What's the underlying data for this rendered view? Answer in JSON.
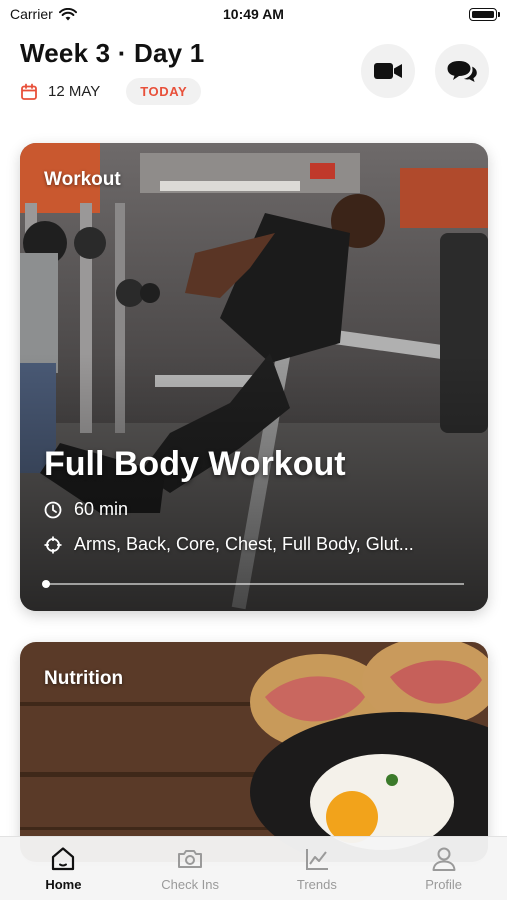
{
  "status_bar": {
    "carrier": "Carrier",
    "time": "10:49 AM"
  },
  "header": {
    "title": "Week 3 · Day 1",
    "date": "12 MAY",
    "today_label": "TODAY"
  },
  "workout_card": {
    "category": "Workout",
    "title": "Full Body Workout",
    "duration": "60 min",
    "targets": "Arms, Back, Core, Chest, Full Body, Glut..."
  },
  "nutrition_card": {
    "category": "Nutrition"
  },
  "tabs": [
    {
      "label": "Home",
      "icon": "home-icon",
      "active": true
    },
    {
      "label": "Check Ins",
      "icon": "camera-icon",
      "active": false
    },
    {
      "label": "Trends",
      "icon": "chart-icon",
      "active": false
    },
    {
      "label": "Profile",
      "icon": "profile-icon",
      "active": false
    }
  ],
  "colors": {
    "accent": "#e8503a",
    "pill_bg": "#f1f1f1",
    "inactive_tab": "#9a9a9a"
  }
}
